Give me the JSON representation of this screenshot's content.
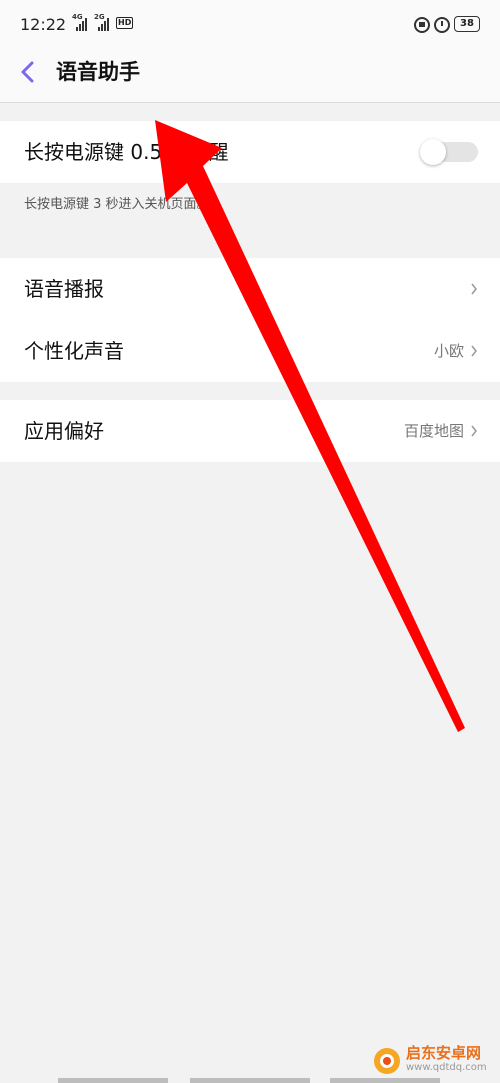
{
  "status_bar": {
    "time": "12:22",
    "signal1": "4G",
    "signal2": "2G",
    "hd": "HD",
    "battery": "38"
  },
  "header": {
    "title": "语音助手",
    "back_icon": "chevron-left-icon",
    "accent_color": "#7b68ee"
  },
  "wake": {
    "label": "长按电源键 0.5 秒唤醒",
    "toggle_on": false,
    "description": "长按电源键 3 秒进入关机页面。"
  },
  "voice": {
    "items": [
      {
        "label": "语音播报",
        "value": ""
      },
      {
        "label": "个性化声音",
        "value": "小欧"
      }
    ]
  },
  "apps": {
    "items": [
      {
        "label": "应用偏好",
        "value": "百度地图"
      }
    ]
  },
  "watermark": {
    "name": "启东安卓网",
    "url": "www.qdtdq.com"
  },
  "overlay_color": "#ff0000"
}
